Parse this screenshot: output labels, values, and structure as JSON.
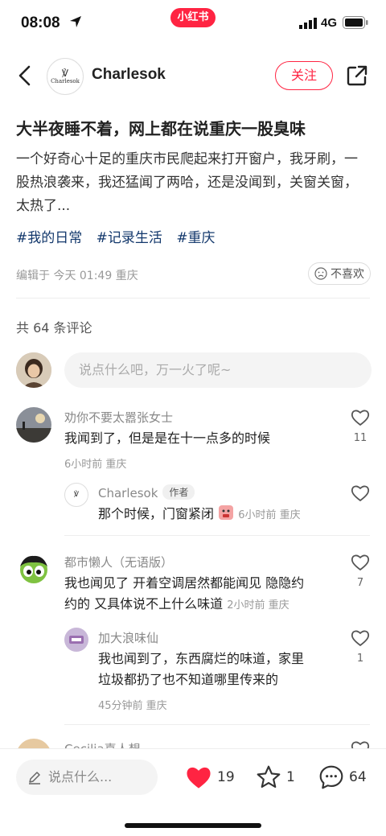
{
  "status_bar": {
    "time": "08:08",
    "network": "4G",
    "app_badge": "小红书"
  },
  "header": {
    "author_name": "Charlesok",
    "brand_mark": "℣",
    "brand_text": "Charlesok",
    "follow_label": "关注"
  },
  "post": {
    "title": "大半夜睡不着，网上都在说重庆一股臭味",
    "body": "一个好奇心十足的重庆市民爬起来打开窗户，我牙刷，一股热浪袭来，我还猛闻了两哈，还是没闻到，关窗关窗，太热了...",
    "tags": [
      "#我的日常",
      "#记录生活",
      "#重庆"
    ],
    "meta": "编辑于 今天 01:49 重庆",
    "dislike_label": "不喜欢"
  },
  "comments_section": {
    "count_label": "共 64 条评论",
    "input_placeholder": "说点什么吧，万一火了呢~"
  },
  "comments": [
    {
      "name": "劝你不要太嚣张女士",
      "text": "我闻到了，但是是在十一点多的时候",
      "meta": "6小时前 重庆",
      "likes": "11"
    },
    {
      "name": "Charlesok",
      "author_tag": "作者",
      "text": "那个时候，门窗紧闭",
      "meta": "6小时前 重庆",
      "likes": ""
    },
    {
      "name": "都市懒人（无语版）",
      "text_line1": "我也闻见了 开着空调居然都能闻见 隐隐约",
      "text_line2": "约的 又具体说不上什么味道",
      "meta": "2小时前 重庆",
      "likes": "7"
    },
    {
      "name": "加大浪味仙",
      "text_line1": "我也闻到了，东西腐烂的味道，家里",
      "text_line2": "垃圾都扔了也不知道哪里传来的",
      "meta": "45分钟前 重庆",
      "likes": "1"
    },
    {
      "name": "Cecilia喜人想"
    }
  ],
  "bottom_bar": {
    "input_placeholder": "说点什么...",
    "likes": "19",
    "collects": "1",
    "comments": "64"
  },
  "colors": {
    "accent": "#ff2442",
    "tag": "#13386c"
  }
}
